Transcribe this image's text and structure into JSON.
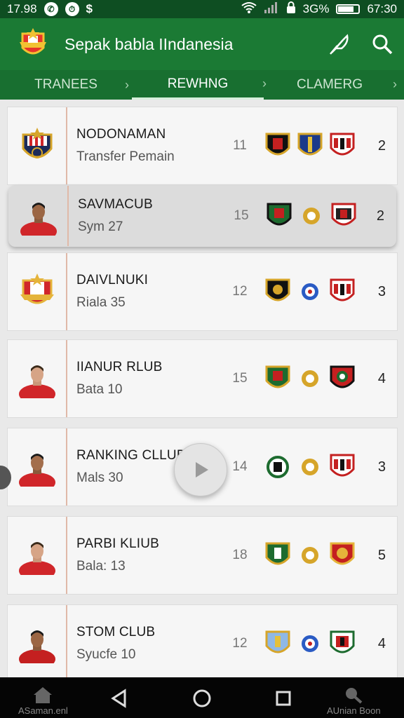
{
  "status_bar": {
    "time": "17.98",
    "battery": "3G%",
    "clock": "67:30"
  },
  "app_bar": {
    "title": "Sepak babla IIndanesia",
    "icons": [
      "feather-icon",
      "search-icon"
    ]
  },
  "tabs": [
    {
      "label": "TRANEES",
      "active": false
    },
    {
      "label": "REWHNG",
      "active": true
    },
    {
      "label": "CLAMERG",
      "active": false
    }
  ],
  "rows": [
    {
      "name": "NODONAMAN",
      "sub": "Transfer Pemain",
      "played": "11",
      "rank": "2",
      "crest": "club-crest"
    },
    {
      "name": "SAVMACUB",
      "sub": "Sym 27",
      "played": "15",
      "rank": "2",
      "crest": "player-photo"
    },
    {
      "name": "DAIVLNUKI",
      "sub": "Riala 35",
      "played": "12",
      "rank": "3",
      "crest": "club-crest"
    },
    {
      "name": "IIANUR RLUB",
      "sub": "Bata 10",
      "played": "15",
      "rank": "4",
      "crest": "player-photo"
    },
    {
      "name": "RANKING CLLUB",
      "sub": "Mals 30",
      "played": "14",
      "rank": "3",
      "crest": "player-photo"
    },
    {
      "name": "PARBI KLIUB",
      "sub": "Bala: 13",
      "played": "18",
      "rank": "5",
      "crest": "player-photo"
    },
    {
      "name": "STOM CLUB",
      "sub": "Syucfe 10",
      "played": "12",
      "rank": "4",
      "crest": "player-photo"
    }
  ],
  "bottom_nav": {
    "left_label": "ASaman.enl",
    "right_label": "AUnian Boon"
  },
  "colors": {
    "primary": "#1b7a34",
    "dark": "#0e4e22",
    "accent": "#d0262a"
  }
}
